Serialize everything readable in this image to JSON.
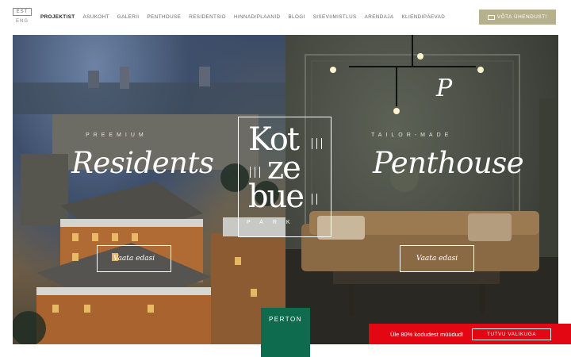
{
  "header": {
    "lang_current": "EST",
    "lang_other": "ENG",
    "nav": [
      {
        "label": "PROJEKTIST",
        "active": true
      },
      {
        "label": "ASUKOHT"
      },
      {
        "label": "GALERII"
      },
      {
        "label": "PENTHOUSE"
      },
      {
        "label": "RESIDENTSID"
      },
      {
        "label": "HINNAD/PLAANID"
      },
      {
        "label": "BLOGI"
      },
      {
        "label": "SISEVIIMISTLUS"
      },
      {
        "label": "ARENDAJA"
      },
      {
        "label": "KLIENDIPÄEVAD"
      }
    ],
    "contact_label": "VÕTA ÜHENDUST!"
  },
  "hero": {
    "left": {
      "eyebrow": "PREEMIUM",
      "title": "Residents",
      "cta": "Vaata edasi"
    },
    "right": {
      "eyebrow": "TAILOR-MADE",
      "title": "Penthouse",
      "cta": "Vaata edasi"
    }
  },
  "logo": {
    "line1": "Kot",
    "line2": "ze",
    "line3": "bue",
    "sub": "PARK"
  },
  "badge": {
    "label": "PERTON",
    "color": "#0f6b4d"
  },
  "banner": {
    "message": "Üle 80% kodudest müüdud!",
    "button": "TUTVU VALIKUGA",
    "color": "#e30613"
  },
  "colors": {
    "accent": "#b6b18c"
  },
  "icons": {
    "contact": "mail-icon",
    "brand": "p-monogram-icon"
  }
}
